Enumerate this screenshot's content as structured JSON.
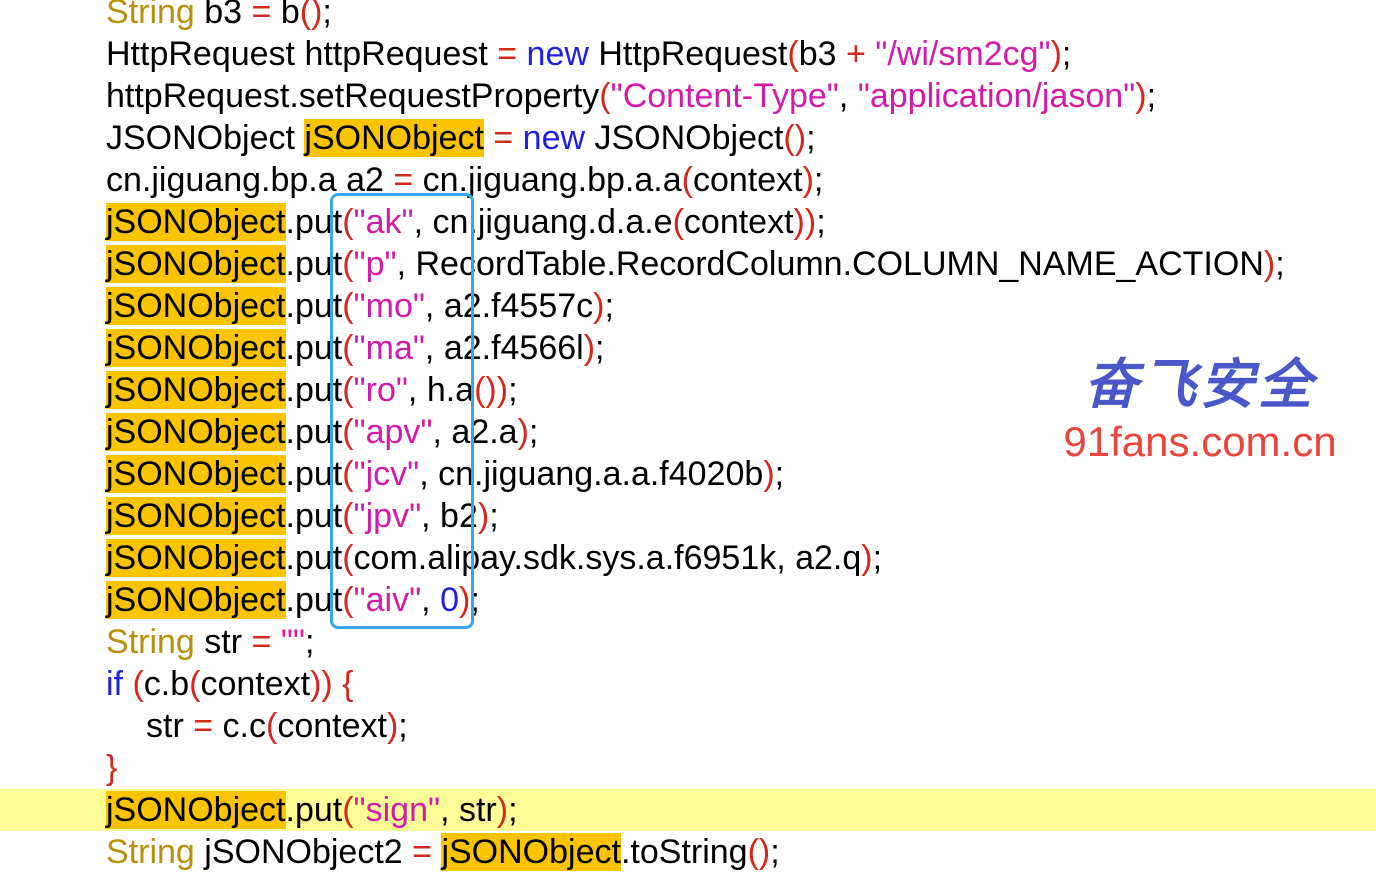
{
  "lines": [
    {
      "tokens": [
        {
          "t": "String",
          "c": "kw"
        },
        {
          "t": " b3 "
        },
        {
          "t": "=",
          "c": "op"
        },
        {
          "t": " b"
        },
        {
          "t": "()",
          "c": "op"
        },
        {
          "t": ";"
        }
      ]
    },
    {
      "tokens": [
        {
          "t": "HttpRequest httpRequest "
        },
        {
          "t": "=",
          "c": "op"
        },
        {
          "t": " "
        },
        {
          "t": "new",
          "c": "new"
        },
        {
          "t": " HttpRequest"
        },
        {
          "t": "(",
          "c": "op"
        },
        {
          "t": "b3 "
        },
        {
          "t": "+",
          "c": "op"
        },
        {
          "t": " "
        },
        {
          "t": "\"/wi/sm2cg\"",
          "c": "str"
        },
        {
          "t": ")",
          "c": "op"
        },
        {
          "t": ";"
        }
      ]
    },
    {
      "tokens": [
        {
          "t": "httpRequest.setRequestProperty"
        },
        {
          "t": "(",
          "c": "op"
        },
        {
          "t": "\"Content-Type\"",
          "c": "str"
        },
        {
          "t": ", "
        },
        {
          "t": "\"application/jason\"",
          "c": "str"
        },
        {
          "t": ")",
          "c": "op"
        },
        {
          "t": ";"
        }
      ]
    },
    {
      "tokens": [
        {
          "t": "JSONObject "
        },
        {
          "t": "jSONObject",
          "c": "hl"
        },
        {
          "t": " "
        },
        {
          "t": "=",
          "c": "op"
        },
        {
          "t": " "
        },
        {
          "t": "new",
          "c": "new"
        },
        {
          "t": " JSONObject"
        },
        {
          "t": "()",
          "c": "op"
        },
        {
          "t": ";"
        }
      ]
    },
    {
      "tokens": [
        {
          "t": "cn.jiguang.bp.a a2 "
        },
        {
          "t": "=",
          "c": "op"
        },
        {
          "t": " cn.jiguang.bp.a.a"
        },
        {
          "t": "(",
          "c": "op"
        },
        {
          "t": "context"
        },
        {
          "t": ")",
          "c": "op"
        },
        {
          "t": ";"
        }
      ]
    },
    {
      "tokens": [
        {
          "t": "jSONObject",
          "c": "hl"
        },
        {
          "t": ".put"
        },
        {
          "t": "(",
          "c": "op"
        },
        {
          "t": "\"ak\"",
          "c": "str"
        },
        {
          "t": ", cn.jiguang.d.a.e"
        },
        {
          "t": "(",
          "c": "op"
        },
        {
          "t": "context"
        },
        {
          "t": "))",
          "c": "op"
        },
        {
          "t": ";"
        }
      ]
    },
    {
      "tokens": [
        {
          "t": "jSONObject",
          "c": "hl"
        },
        {
          "t": ".put"
        },
        {
          "t": "(",
          "c": "op"
        },
        {
          "t": "\"p\"",
          "c": "str"
        },
        {
          "t": ", RecordTable.RecordColumn.COLUMN_NAME_ACTION"
        },
        {
          "t": ")",
          "c": "op"
        },
        {
          "t": ";"
        }
      ]
    },
    {
      "tokens": [
        {
          "t": "jSONObject",
          "c": "hl"
        },
        {
          "t": ".put"
        },
        {
          "t": "(",
          "c": "op"
        },
        {
          "t": "\"mo\"",
          "c": "str"
        },
        {
          "t": ", a2.f4557c"
        },
        {
          "t": ")",
          "c": "op"
        },
        {
          "t": ";"
        }
      ]
    },
    {
      "tokens": [
        {
          "t": "jSONObject",
          "c": "hl"
        },
        {
          "t": ".put"
        },
        {
          "t": "(",
          "c": "op"
        },
        {
          "t": "\"ma\"",
          "c": "str"
        },
        {
          "t": ", a2.f4566l"
        },
        {
          "t": ")",
          "c": "op"
        },
        {
          "t": ";"
        }
      ]
    },
    {
      "tokens": [
        {
          "t": "jSONObject",
          "c": "hl"
        },
        {
          "t": ".put"
        },
        {
          "t": "(",
          "c": "op"
        },
        {
          "t": "\"ro\"",
          "c": "str"
        },
        {
          "t": ", h.a"
        },
        {
          "t": "())",
          "c": "op"
        },
        {
          "t": ";"
        }
      ]
    },
    {
      "tokens": [
        {
          "t": "jSONObject",
          "c": "hl"
        },
        {
          "t": ".put"
        },
        {
          "t": "(",
          "c": "op"
        },
        {
          "t": "\"apv\"",
          "c": "str"
        },
        {
          "t": ", a2.a"
        },
        {
          "t": ")",
          "c": "op"
        },
        {
          "t": ";"
        }
      ]
    },
    {
      "tokens": [
        {
          "t": "jSONObject",
          "c": "hl"
        },
        {
          "t": ".put"
        },
        {
          "t": "(",
          "c": "op"
        },
        {
          "t": "\"jcv\"",
          "c": "str"
        },
        {
          "t": ", cn.jiguang.a.a.f4020b"
        },
        {
          "t": ")",
          "c": "op"
        },
        {
          "t": ";"
        }
      ]
    },
    {
      "tokens": [
        {
          "t": "jSONObject",
          "c": "hl"
        },
        {
          "t": ".put"
        },
        {
          "t": "(",
          "c": "op"
        },
        {
          "t": "\"jpv\"",
          "c": "str"
        },
        {
          "t": ", b2"
        },
        {
          "t": ")",
          "c": "op"
        },
        {
          "t": ";"
        }
      ]
    },
    {
      "tokens": [
        {
          "t": "jSONObject",
          "c": "hl"
        },
        {
          "t": ".put"
        },
        {
          "t": "(",
          "c": "op"
        },
        {
          "t": "com.alipay.sdk.sys.a.f6951k, a2.q"
        },
        {
          "t": ")",
          "c": "op"
        },
        {
          "t": ";"
        }
      ]
    },
    {
      "tokens": [
        {
          "t": "jSONObject",
          "c": "hl"
        },
        {
          "t": ".put"
        },
        {
          "t": "(",
          "c": "op"
        },
        {
          "t": "\"aiv\"",
          "c": "str"
        },
        {
          "t": ", "
        },
        {
          "t": "0",
          "c": "num"
        },
        {
          "t": ")",
          "c": "op"
        },
        {
          "t": ";"
        }
      ]
    },
    {
      "tokens": [
        {
          "t": "String",
          "c": "kw"
        },
        {
          "t": " str "
        },
        {
          "t": "=",
          "c": "op"
        },
        {
          "t": " "
        },
        {
          "t": "\"\"",
          "c": "str"
        },
        {
          "t": ";"
        }
      ]
    },
    {
      "tokens": [
        {
          "t": "if",
          "c": "new"
        },
        {
          "t": " "
        },
        {
          "t": "(",
          "c": "op"
        },
        {
          "t": "c.b"
        },
        {
          "t": "(",
          "c": "op"
        },
        {
          "t": "context"
        },
        {
          "t": ")) {",
          "c": "op"
        }
      ]
    },
    {
      "indent": true,
      "tokens": [
        {
          "t": "str "
        },
        {
          "t": "=",
          "c": "op"
        },
        {
          "t": " c.c"
        },
        {
          "t": "(",
          "c": "op"
        },
        {
          "t": "context"
        },
        {
          "t": ")",
          "c": "op"
        },
        {
          "t": ";"
        }
      ]
    },
    {
      "tokens": [
        {
          "t": "}",
          "c": "op"
        }
      ]
    },
    {
      "active": true,
      "tokens": [
        {
          "t": "jSONObject",
          "c": "hl"
        },
        {
          "t": ".put"
        },
        {
          "t": "(",
          "c": "op"
        },
        {
          "t": "\"sign\"",
          "c": "str"
        },
        {
          "t": ", str"
        },
        {
          "t": ")",
          "c": "op"
        },
        {
          "t": ";"
        }
      ]
    },
    {
      "tokens": [
        {
          "t": "String",
          "c": "kw"
        },
        {
          "t": " jSONObject2 "
        },
        {
          "t": "=",
          "c": "op"
        },
        {
          "t": " "
        },
        {
          "t": "jSONObject",
          "c": "hl"
        },
        {
          "t": ".toString"
        },
        {
          "t": "()",
          "c": "op"
        },
        {
          "t": ";"
        }
      ]
    }
  ],
  "watermark": {
    "logo_text": "奋飞安全",
    "url": "91fans.com.cn"
  },
  "colors": {
    "keyword": "#b8900c",
    "new_keyword": "#1f1fe0",
    "string": "#d41aa8",
    "operator": "#d4281c",
    "highlight": "#fbc400",
    "active_line": "#fdfd98",
    "selection_box": "#3aa5ea",
    "watermark_logo": "#4a57c9",
    "watermark_url": "#e8453c"
  }
}
